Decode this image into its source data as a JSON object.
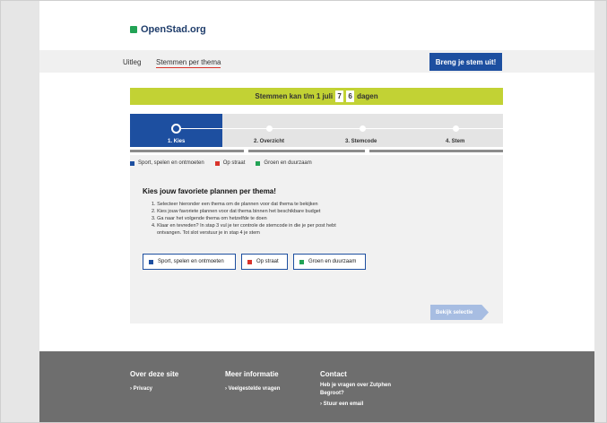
{
  "header": {
    "logo_text": "OpenStad.org",
    "nav": {
      "uitleg": "Uitleg",
      "stemmen": "Stemmen per thema"
    },
    "vote_button": "Breng je stem uit!"
  },
  "banner": {
    "prefix": "Stemmen kan t/m 1 juli",
    "digits": [
      "7",
      "6"
    ],
    "suffix": "dagen"
  },
  "steps": [
    {
      "label": "1. Kies"
    },
    {
      "label": "2. Overzicht"
    },
    {
      "label": "3. Stemcode"
    },
    {
      "label": "4. Stem"
    }
  ],
  "themes": [
    {
      "label": "Sport, spelen en ontmoeten",
      "color": "#1d4fa0"
    },
    {
      "label": "Op straat",
      "color": "#d9342b"
    },
    {
      "label": "Groen en duurzaam",
      "color": "#22a355"
    }
  ],
  "content": {
    "title": "Kies jouw favoriete plannen per thema!",
    "instructions": [
      "1. Selecteer hieronder een thema om de plannen voor dat thema te bekijken",
      "2. Kies jouw favoriete plannen voor dat thema binnen het beschikbare budget",
      "3. Ga naar het volgende thema om hetzelfde te doen",
      "4. Klaar en tevreden? In stap 3 vul je ter controle de stemcode in die je per post hebt",
      "ontvangen. Tot slot verstuur je in stap 4 je stem"
    ],
    "bekijk_button": "Bekijk selectie"
  },
  "footer": {
    "over": {
      "title": "Over deze site",
      "link": "Privacy"
    },
    "meer": {
      "title": "Meer informatie",
      "link": "Veelgestelde vragen"
    },
    "contact": {
      "title": "Contact",
      "text1": "Heb je vragen over Zutphen",
      "text2": "Begroot?",
      "link": "Stuur een email"
    }
  },
  "colors": {
    "primary": "#1d4fa0",
    "banner": "#c2d234",
    "footer": "#6e6e6e",
    "logo": "#22a355"
  }
}
